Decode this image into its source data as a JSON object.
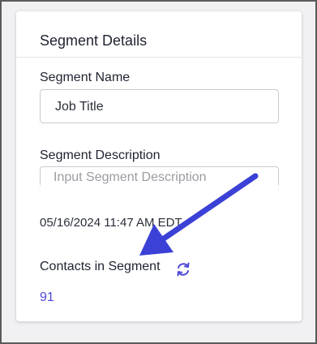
{
  "card": {
    "title": "Segment Details"
  },
  "segment_name": {
    "label": "Segment Name",
    "value": "Job Title"
  },
  "segment_description": {
    "label": "Segment Description",
    "placeholder": "Input Segment Description"
  },
  "timestamp": "05/16/2024 11:47 AM EDT",
  "contacts": {
    "label": "Contacts in Segment",
    "count": "91"
  },
  "icons": {
    "refresh": "refresh-icon"
  },
  "colors": {
    "accent": "#4e48d6",
    "arrow": "#3b41d6"
  }
}
